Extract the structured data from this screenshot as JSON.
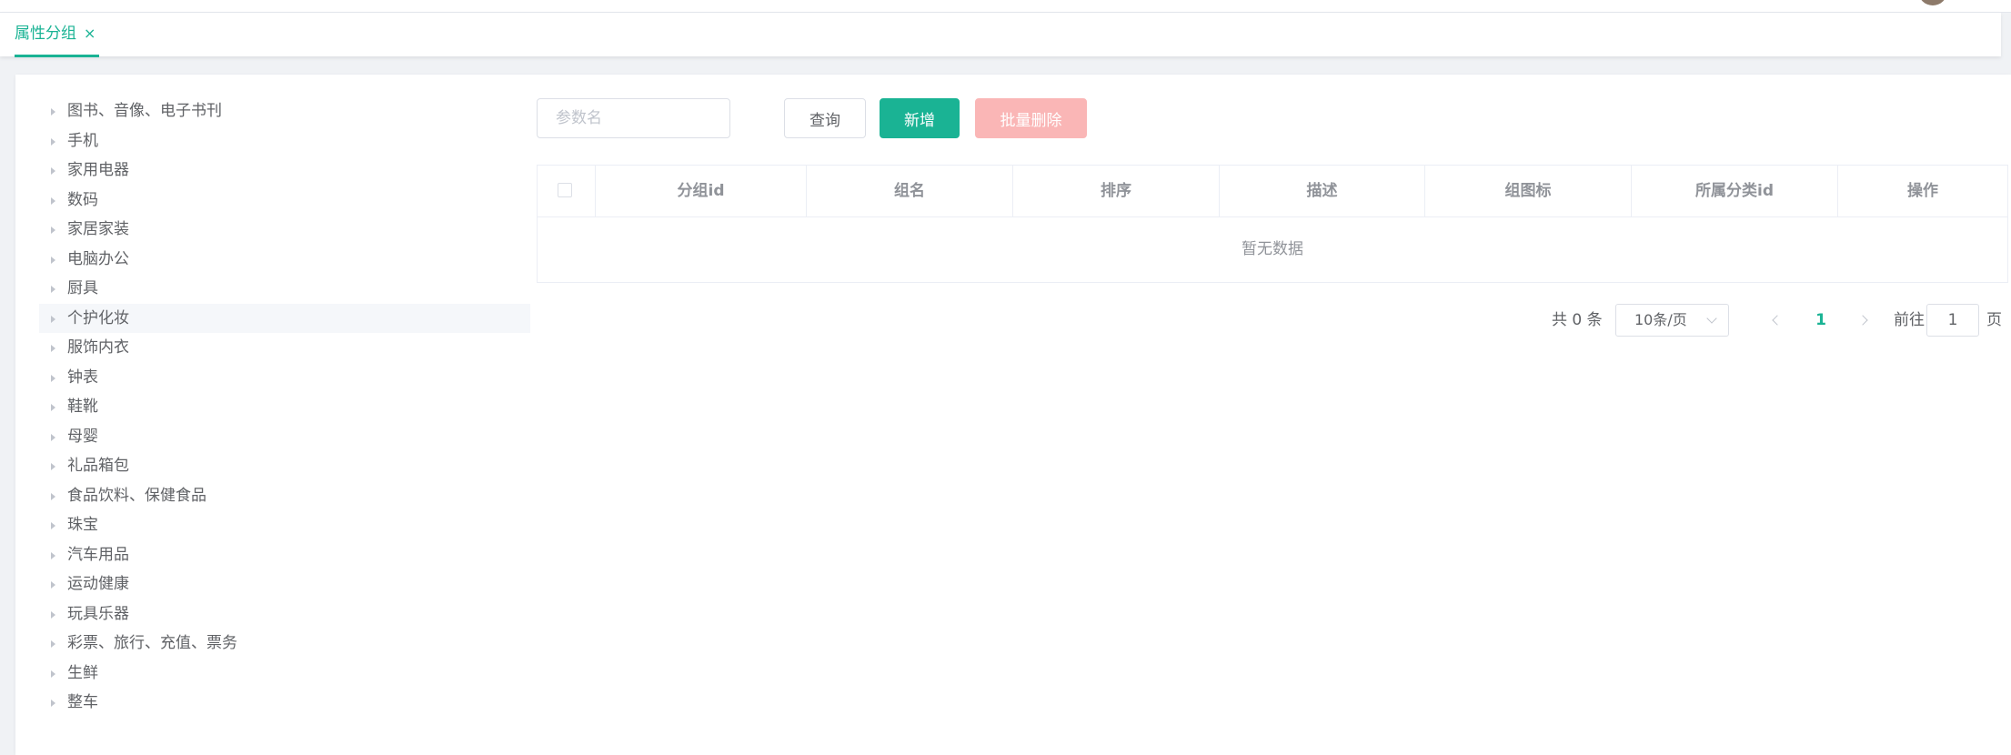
{
  "tabs": [
    {
      "label": "属性分组",
      "close": "×"
    }
  ],
  "tree": {
    "items": [
      {
        "label": "图书、音像、电子书刊"
      },
      {
        "label": "手机"
      },
      {
        "label": "家用电器"
      },
      {
        "label": "数码"
      },
      {
        "label": "家居家装"
      },
      {
        "label": "电脑办公"
      },
      {
        "label": "厨具"
      },
      {
        "label": "个护化妆"
      },
      {
        "label": "服饰内衣"
      },
      {
        "label": "钟表"
      },
      {
        "label": "鞋靴"
      },
      {
        "label": "母婴"
      },
      {
        "label": "礼品箱包"
      },
      {
        "label": "食品饮料、保健食品"
      },
      {
        "label": "珠宝"
      },
      {
        "label": "汽车用品"
      },
      {
        "label": "运动健康"
      },
      {
        "label": "玩具乐器"
      },
      {
        "label": "彩票、旅行、充值、票务"
      },
      {
        "label": "生鲜"
      },
      {
        "label": "整车"
      }
    ]
  },
  "toolbar": {
    "search_placeholder": "参数名",
    "query_label": "查询",
    "add_label": "新增",
    "batch_delete_label": "批量删除"
  },
  "table": {
    "columns": [
      "分组id",
      "组名",
      "排序",
      "描述",
      "组图标",
      "所属分类id",
      "操作"
    ],
    "empty_text": "暂无数据"
  },
  "pagination": {
    "total_text": "共 0 条",
    "page_size": "10条/页",
    "current_page": "1",
    "goto_prefix": "前往",
    "goto_value": "1",
    "goto_suffix": "页"
  },
  "colors": {
    "accent": "#1ab394",
    "danger_disabled": "#fab6b6",
    "highlight_row": "#f5f7fa"
  }
}
